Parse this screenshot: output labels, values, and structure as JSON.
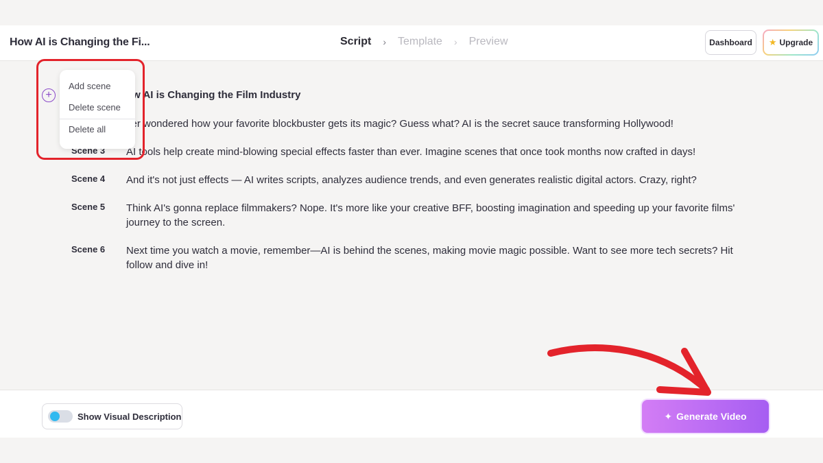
{
  "header": {
    "project_title": "How AI is Changing the Fi...",
    "steps": [
      {
        "label": "Script",
        "state": "active"
      },
      {
        "label": "Template",
        "state": "inactive"
      },
      {
        "label": "Preview",
        "state": "inactive"
      }
    ],
    "dashboard_label": "Dashboard",
    "upgrade_label": "Upgrade"
  },
  "script": {
    "title": "ow AI is Changing the Film Industry",
    "scenes": [
      {
        "label": "",
        "text": "ver wondered how your favorite blockbuster gets its magic? Guess what? AI is the secret sauce transforming Hollywood!"
      },
      {
        "label": "Scene 3",
        "text": "AI tools help create mind-blowing special effects faster than ever. Imagine scenes that once took months now crafted in days!"
      },
      {
        "label": "Scene 4",
        "text": "And it's not just effects — AI writes scripts, analyzes audience trends, and even generates realistic digital actors. Crazy, right?"
      },
      {
        "label": "Scene 5",
        "text": "Think AI's gonna replace filmmakers? Nope. It's more like your creative BFF, boosting imagination and speeding up your favorite films' journey to the screen."
      },
      {
        "label": "Scene 6",
        "text": "Next time you watch a movie, remember—AI is behind the scenes, making movie magic possible. Want to see more tech secrets? Hit follow and dive in!"
      }
    ]
  },
  "context_menu": {
    "items": [
      "Add scene",
      "Delete scene",
      "Delete all"
    ]
  },
  "footer": {
    "toggle_label": "Show Visual Description",
    "toggle_on": true,
    "generate_label": "Generate Video"
  },
  "colors": {
    "accent_purple": "#a65ef2",
    "highlight_red": "#e3232b",
    "toggle_knob": "#31b9f0"
  },
  "icons": [
    "chevron-right-icon",
    "star-icon",
    "plus-circle-icon",
    "sparkle-icon",
    "annotation-arrow"
  ]
}
